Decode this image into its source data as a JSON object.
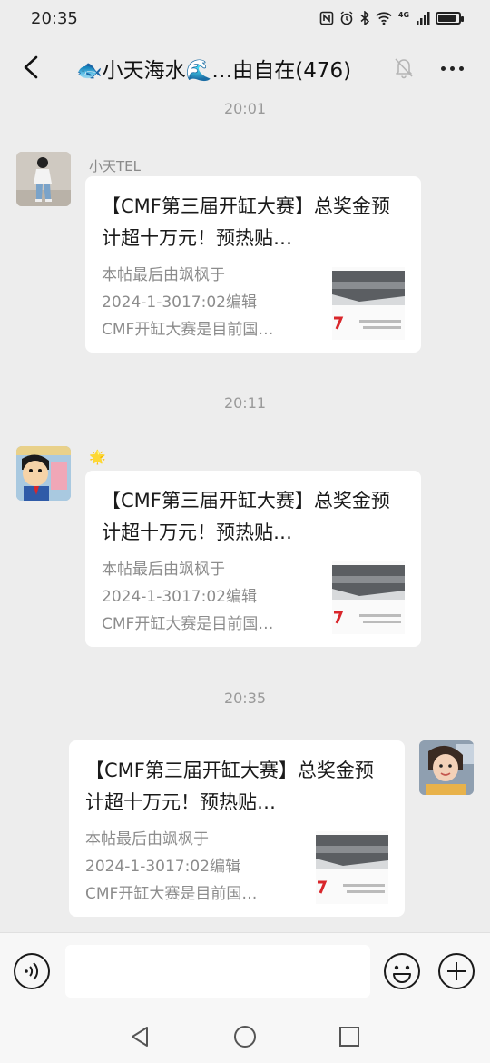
{
  "status_bar": {
    "time": "20:35",
    "icons": [
      "nfc-icon",
      "alarm-icon",
      "bluetooth-icon",
      "wifi-icon",
      "signal-icon",
      "battery-icon"
    ],
    "network_label": "4G",
    "battery_level": 0.85
  },
  "header": {
    "title": "🐟小天海水🌊…由自在(476)",
    "muted": true
  },
  "messages": [
    {
      "time": "20:01",
      "sender": "小天TEL",
      "side": "left",
      "card": {
        "title": "【CMF第三届开缸大赛】总奖金预计超十万元！预热贴…",
        "desc_lines": [
          "本帖最后由飒枫于",
          "2024-1-3017:02编辑",
          "CMF开缸大赛是目前国…"
        ]
      }
    },
    {
      "time": "20:11",
      "sender": "🌟",
      "side": "left",
      "card": {
        "title": "【CMF第三届开缸大赛】总奖金预计超十万元！预热贴…",
        "desc_lines": [
          "本帖最后由飒枫于",
          "2024-1-3017:02编辑",
          "CMF开缸大赛是目前国…"
        ]
      }
    },
    {
      "time": "20:35",
      "sender": "",
      "side": "right",
      "card": {
        "title": "【CMF第三届开缸大赛】总奖金预计超十万元！预热贴…",
        "desc_lines": [
          "本帖最后由飒枫于",
          "2024-1-3017:02编辑",
          "CMF开缸大赛是目前国…"
        ]
      }
    }
  ],
  "input_bar": {
    "placeholder": "",
    "value": ""
  },
  "colors": {
    "background": "#ededed",
    "card": "#ffffff",
    "timestamp": "#9a9a9a",
    "accent_red": "#d9262b"
  }
}
